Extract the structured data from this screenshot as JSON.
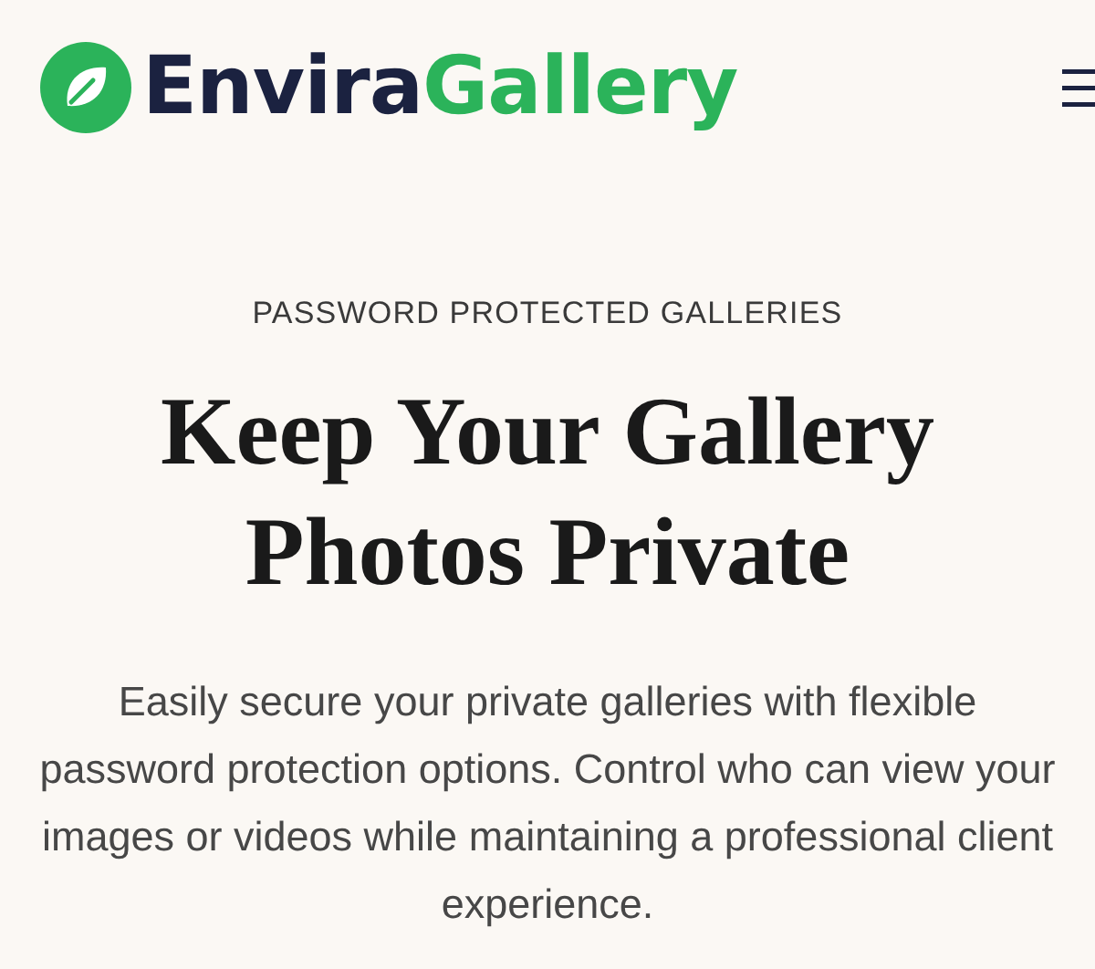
{
  "header": {
    "logo": {
      "brand_part_1": "Envira",
      "brand_part_2": "Gallery"
    }
  },
  "hero": {
    "eyebrow": "PASSWORD PROTECTED GALLERIES",
    "title": "Keep Your Gallery Photos Private",
    "description": "Easily secure your private galleries with flexible password protection options. Control who can view your images or videos while maintaining a professional client experience."
  }
}
